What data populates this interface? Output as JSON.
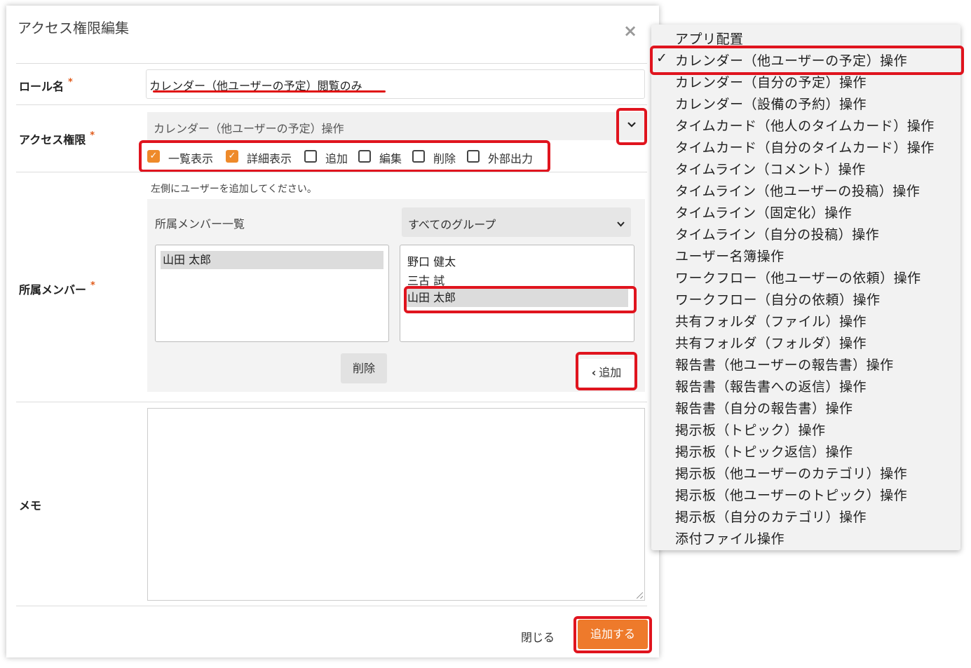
{
  "modal": {
    "title": "アクセス権限編集",
    "close_icon": "×",
    "role_name": {
      "label": "ロール名",
      "required_mark": "*",
      "value": "カレンダー（他ユーザーの予定）閲覧のみ"
    },
    "access": {
      "label": "アクセス権限",
      "required_mark": "*",
      "selected": "カレンダー（他ユーザーの予定）操作",
      "dropdown_icon": "chevron-down-icon",
      "permissions": [
        {
          "label": "一覧表示",
          "checked": true
        },
        {
          "label": "詳細表示",
          "checked": true
        },
        {
          "label": "追加",
          "checked": false
        },
        {
          "label": "編集",
          "checked": false
        },
        {
          "label": "削除",
          "checked": false
        },
        {
          "label": "外部出力",
          "checked": false
        }
      ]
    },
    "members": {
      "label": "所属メンバー",
      "required_mark": "*",
      "hint": "左側にユーザーを追加してください。",
      "list_title": "所属メンバー一覧",
      "group_select": "すべてのグループ",
      "current_members": [
        "山田 太郎"
      ],
      "available_users": [
        "野口 健太",
        "三古 試",
        "山田 太郎"
      ],
      "delete_button": "削除",
      "add_button": "追加",
      "add_icon": "‹"
    },
    "memo": {
      "label": "メモ",
      "value": ""
    },
    "footer": {
      "close": "閉じる",
      "submit": "追加する"
    }
  },
  "dropdown": {
    "check_icon": "✓",
    "options": [
      "アプリ配置",
      "カレンダー（他ユーザーの予定）操作",
      "カレンダー（自分の予定）操作",
      "カレンダー（設備の予約）操作",
      "タイムカード（他人のタイムカード）操作",
      "タイムカード（自分のタイムカード）操作",
      "タイムライン（コメント）操作",
      "タイムライン（他ユーザーの投稿）操作",
      "タイムライン（固定化）操作",
      "タイムライン（自分の投稿）操作",
      "ユーザー名簿操作",
      "ワークフロー（他ユーザーの依頼）操作",
      "ワークフロー（自分の依頼）操作",
      "共有フォルダ（ファイル）操作",
      "共有フォルダ（フォルダ）操作",
      "報告書（他ユーザーの報告書）操作",
      "報告書（報告書への返信）操作",
      "報告書（自分の報告書）操作",
      "掲示板（トピック）操作",
      "掲示板（トピック返信）操作",
      "掲示板（他ユーザーのカテゴリ）操作",
      "掲示板（他ユーザーのトピック）操作",
      "掲示板（自分のカテゴリ）操作",
      "添付ファイル操作"
    ]
  }
}
